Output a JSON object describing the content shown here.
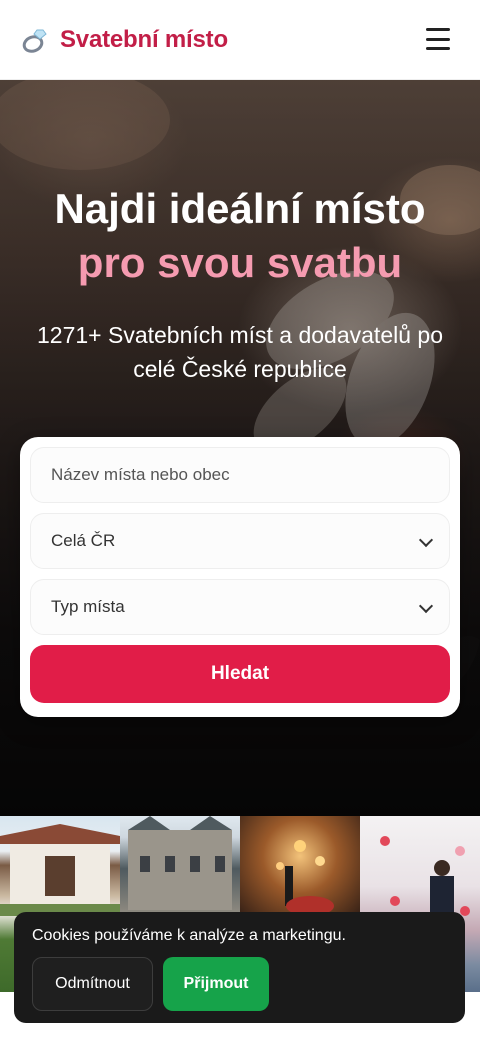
{
  "header": {
    "brand": "Svatební místo",
    "logo_icon": "ring-icon",
    "menu_icon": "hamburger-menu-icon"
  },
  "hero": {
    "title": "Najdi ideální místo",
    "accent": "pro svou svatbu",
    "subtitle": "1271+ Svatebních míst a dodavatelů po celé České republice"
  },
  "search": {
    "name_placeholder": "Název místa nebo obec",
    "region_value": "Celá ČR",
    "type_value": "Typ místa",
    "submit_label": "Hledat"
  },
  "cookie": {
    "message": "Cookies používáme k analýze a marketingu.",
    "decline_label": "Odmítnout",
    "accept_label": "Přijmout"
  },
  "colors": {
    "brand": "#c21e47",
    "accent": "#f59bb0",
    "primary_button": "#e11d48",
    "accept_button": "#16a34a"
  }
}
